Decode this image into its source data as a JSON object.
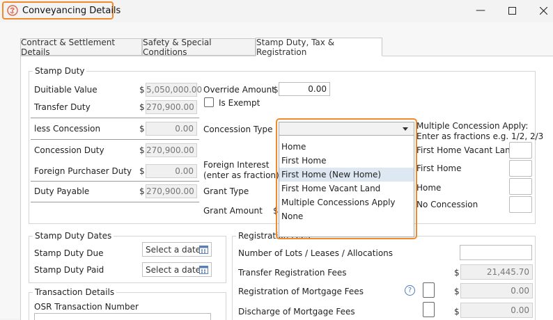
{
  "window": {
    "title": "Conveyancing Details"
  },
  "tabs": [
    {
      "label": "Contract & Settlement Details"
    },
    {
      "label": "Safety & Special Conditions"
    },
    {
      "label": "Stamp Duty, Tax & Registration"
    }
  ],
  "stamp_duty": {
    "title": "Stamp Duty",
    "currency": "$",
    "dutiable_value": {
      "label": "Duitiable Value",
      "value": "5,050,000.00"
    },
    "transfer_duty": {
      "label": "Transfer Duty",
      "value": "270,900.00"
    },
    "less_concession": {
      "label": "less Concession",
      "value": "0.00"
    },
    "concession_duty": {
      "label": "Concession Duty",
      "value": "270,900.00"
    },
    "foreign_purchaser_duty": {
      "label": "Foreign Purchaser Duty",
      "value": "0.00"
    },
    "duty_payable": {
      "label": "Duty Payable",
      "value": "270,900.00"
    },
    "override_amount": {
      "label": "Override Amount",
      "value": "0.00"
    },
    "is_exempt": {
      "label": "Is Exempt"
    },
    "concession_type": {
      "label": "Concession Type",
      "value": ""
    },
    "foreign_interest": {
      "label_line1": "Foreign Interest",
      "label_line2": "(enter as fraction)"
    },
    "grant_type": {
      "label": "Grant Type"
    },
    "grant_amount": {
      "label": "Grant Amount"
    },
    "multiple_concession": {
      "label_line1": "Multiple Concession Apply:",
      "label_line2": "Enter as fractions e.g. 1/2, 2/3",
      "items": [
        {
          "label": "First Home Vacant Land"
        },
        {
          "label": "First Home"
        },
        {
          "label": "Home"
        },
        {
          "label": "No Concession"
        }
      ]
    }
  },
  "concession_dropdown": {
    "options": [
      {
        "label": "Home"
      },
      {
        "label": "First Home"
      },
      {
        "label": "First Home (New Home)"
      },
      {
        "label": "First Home Vacant Land"
      },
      {
        "label": "Multiple Concessions Apply"
      },
      {
        "label": "None"
      }
    ],
    "highlighted": "First Home (New Home)"
  },
  "stamp_duty_dates": {
    "title": "Stamp Duty Dates",
    "due": {
      "label": "Stamp Duty Due",
      "placeholder": "Select a date"
    },
    "paid": {
      "label": "Stamp Duty Paid",
      "placeholder": "Select a date"
    }
  },
  "transaction_details": {
    "title": "Transaction Details",
    "osr_label": "OSR Transaction Number"
  },
  "registration_fees": {
    "title": "Registration Fees",
    "currency": "$",
    "lots": {
      "label": "Number of Lots / Leases / Allocations"
    },
    "transfer": {
      "label": "Transfer Registration Fees",
      "value": "21,445.70"
    },
    "mortgage": {
      "label": "Registration of Mortgage Fees",
      "value": "0.00"
    },
    "discharge": {
      "label": "Discharge of Mortgage Fees",
      "value": "0.00"
    },
    "help_symbol": "?"
  },
  "colors": {
    "accent": "#f08a2a",
    "highlight": "#dde8f3"
  }
}
